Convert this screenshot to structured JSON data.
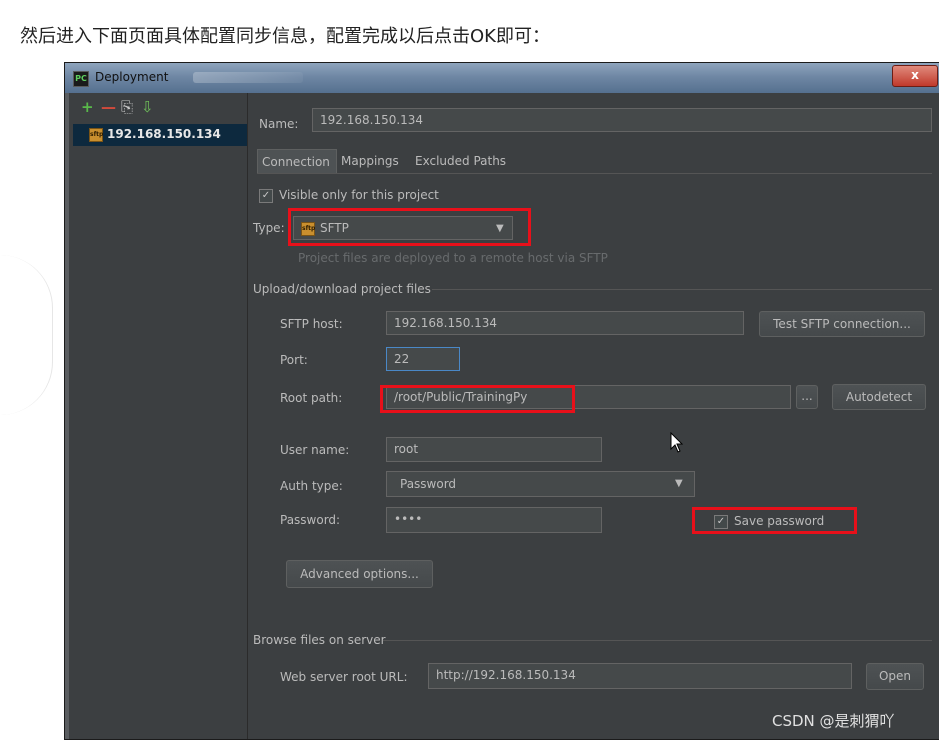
{
  "caption": "然后进入下面页面具体配置同步信息，配置完成以后点击OK即可：",
  "window": {
    "title": "Deployment",
    "app_icon": "PC",
    "close_label": "x"
  },
  "left_panel": {
    "toolbar": {
      "add_label": "+",
      "remove_label": "—",
      "copy_label": "⎘",
      "default_label": "⇩"
    },
    "servers": [
      {
        "icon": "sftp-server-icon",
        "icon_text": "sftp",
        "label": "192.168.150.134"
      }
    ]
  },
  "name": {
    "label": "Name:",
    "value": "192.168.150.134"
  },
  "tabs": [
    "Connection",
    "Mappings",
    "Excluded Paths"
  ],
  "active_tab": "Connection",
  "visible_only": {
    "label": "Visible only for this project",
    "checked": true
  },
  "type": {
    "label": "Type:",
    "value": "SFTP",
    "icon_text": "sftp",
    "hint": "Project files are deployed to a remote host via SFTP"
  },
  "upload_section": {
    "title": "Upload/download project files"
  },
  "sftp_host": {
    "label": "SFTP host:",
    "value": "192.168.150.134"
  },
  "test_button": {
    "label": "Test SFTP connection..."
  },
  "port": {
    "label": "Port:",
    "value": "22"
  },
  "root_path": {
    "label": "Root path:",
    "value": "/root/Public/TrainingPy"
  },
  "browse_button": {
    "label": "..."
  },
  "autodetect_button": {
    "label": "Autodetect"
  },
  "user_name": {
    "label": "User name:",
    "value": "root"
  },
  "auth_type": {
    "label": "Auth type:",
    "value": "Password"
  },
  "password": {
    "label": "Password:",
    "value": "••••"
  },
  "save_password": {
    "label": "Save password",
    "checked": true
  },
  "advanced_button": {
    "label": "Advanced options..."
  },
  "browse_section": {
    "title": "Browse files on server"
  },
  "web_root": {
    "label": "Web server root URL:",
    "value": "http://192.168.150.134"
  },
  "open_button": {
    "label": "Open"
  },
  "watermark": "CSDN @是刺猬吖",
  "colors": {
    "highlight_box": "#e8101a",
    "panel_bg": "#3c3f41",
    "selection_bg": "#0d293e",
    "text": "#bbbbbb"
  }
}
